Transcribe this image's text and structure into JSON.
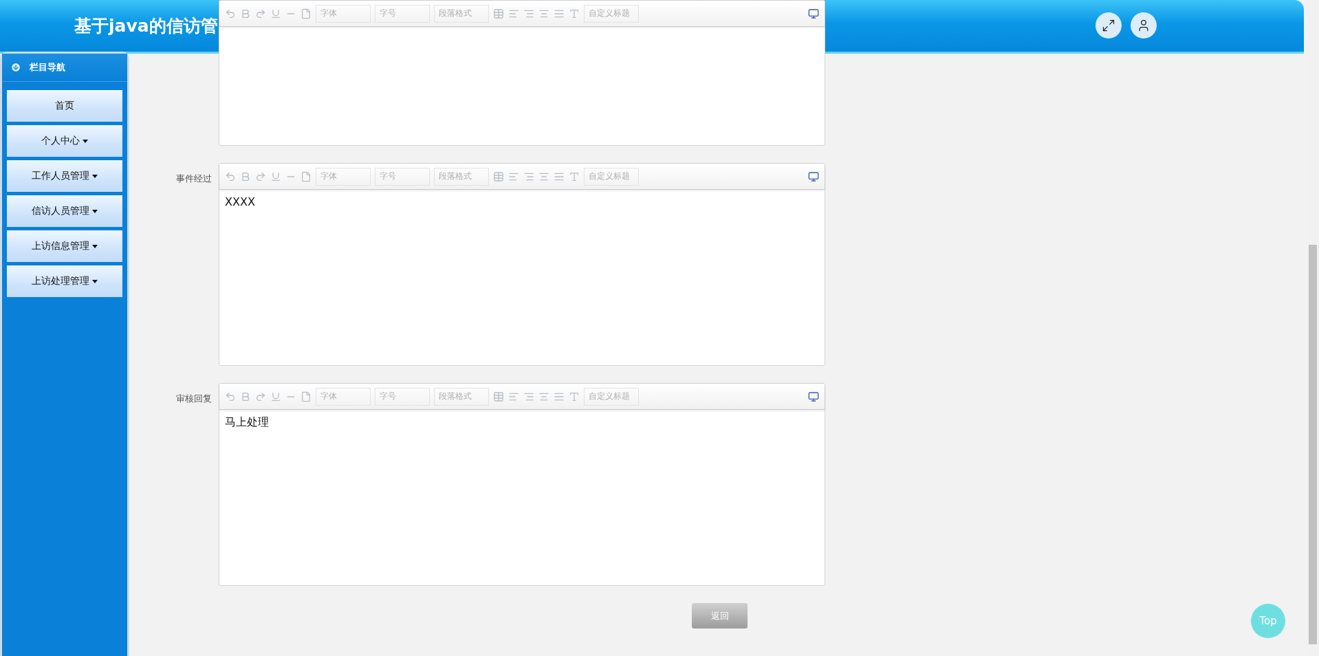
{
  "header": {
    "title": "基于java的信访管"
  },
  "sidebar": {
    "title": "栏目导航",
    "items": [
      {
        "label": "首页",
        "has_dropdown": false
      },
      {
        "label": "个人中心",
        "has_dropdown": true
      },
      {
        "label": "工作人员管理",
        "has_dropdown": true
      },
      {
        "label": "信访人员管理",
        "has_dropdown": true
      },
      {
        "label": "上访信息管理",
        "has_dropdown": true
      },
      {
        "label": "上访处理管理",
        "has_dropdown": true
      }
    ]
  },
  "form": {
    "fields": [
      {
        "toolbar_disabled": true,
        "toolbar_selects": [
          "字体",
          "字号",
          "段落格式",
          "自定义标题"
        ]
      },
      {
        "label": "事件经过",
        "toolbar_disabled": true,
        "toolbar_selects": [
          "字体",
          "字号",
          "段落格式",
          "自定义标题"
        ],
        "content": "XXXX"
      },
      {
        "label": "审核回复",
        "toolbar_disabled": true,
        "toolbar_selects": [
          "字体",
          "字号",
          "段落格式",
          "自定义标题"
        ],
        "content": "马上处理"
      }
    ]
  },
  "buttons": [
    {
      "label": "返回"
    }
  ],
  "back_to_top": "Top"
}
